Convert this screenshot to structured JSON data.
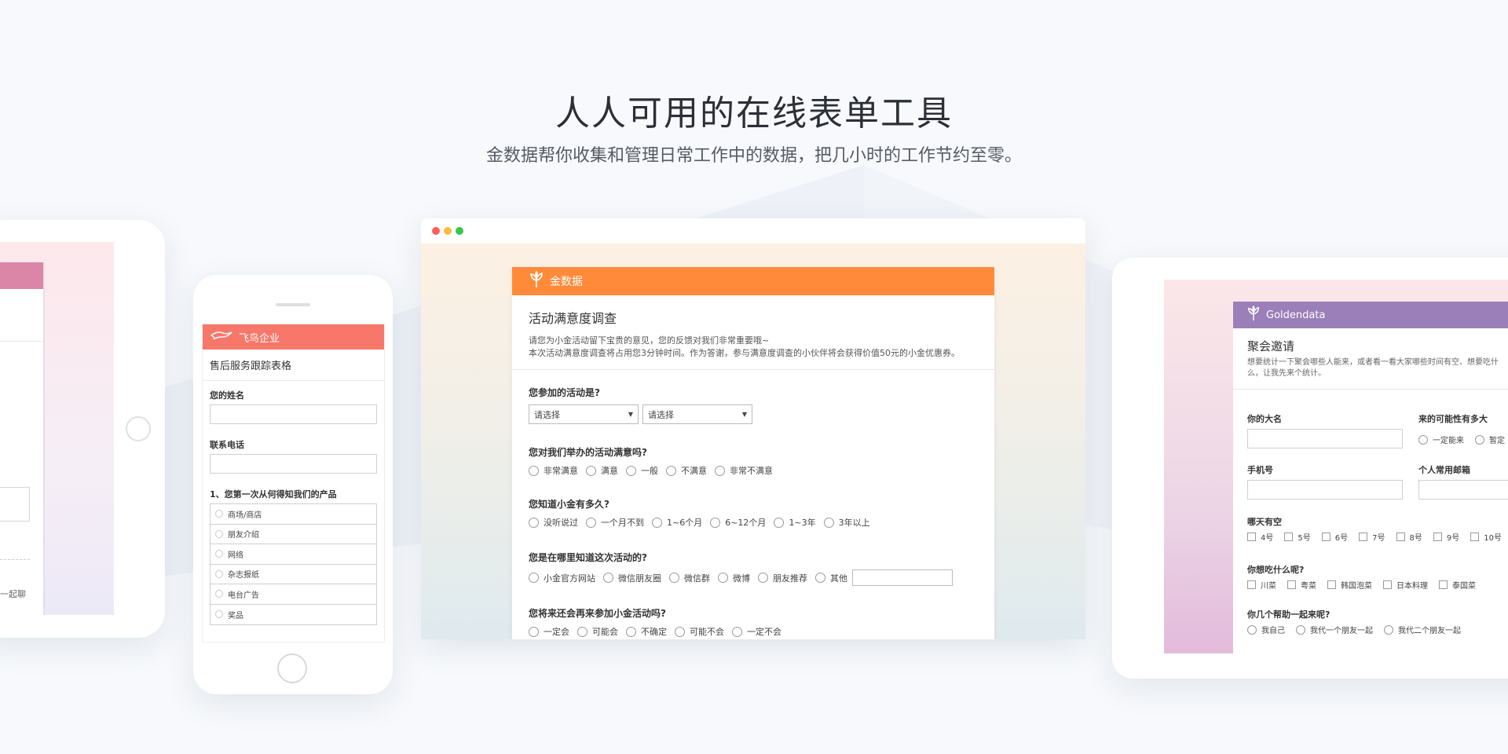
{
  "hero": {
    "title": "人人可用的在线表单工具",
    "subtitle": "金数据帮你收集和管理日常工作中的数据，把几小时的工作节约至零。"
  },
  "colors": {
    "browser_accent": "#ff8a3a",
    "phone_accent": "#f7786a",
    "tablet_right_accent": "#9a7fb8",
    "tablet_left_accent": "#db86a6"
  },
  "tablet_left": {
    "cut_text": "一起聊"
  },
  "phone": {
    "brand": "飞鸟企业",
    "logo_icon": "bird-icon",
    "form_title": "售后服务跟踪表格",
    "fields": [
      {
        "label": "您的姓名"
      },
      {
        "label": "联系电话"
      }
    ],
    "question": "1、您第一次从何得知我们的产品",
    "options": [
      "商场/商店",
      "朋友介绍",
      "网络",
      "杂志报纸",
      "电台广告",
      "奖品"
    ]
  },
  "browser": {
    "brand": "金数据",
    "logo_icon": "sprout-icon",
    "form_title": "活动满意度调查",
    "desc_line1": "请您为小金活动留下宝贵的意见，您的反馈对我们非常重要哦~",
    "desc_line2": "本次活动满意度调查将占用您3分钟时间。作为答谢，参与满意度调查的小伙伴将会获得价值50元的小金优惠券。",
    "questions": [
      {
        "label": "您参加的活动是?",
        "selects": [
          "请选择",
          "请选择"
        ]
      },
      {
        "label": "您对我们举办的活动满意吗?",
        "options": [
          "非常满意",
          "满意",
          "一般",
          "不满意",
          "非常不满意"
        ]
      },
      {
        "label": "您知道小金有多久?",
        "options": [
          "没听说过",
          "一个月不到",
          "1~6个月",
          "6~12个月",
          "1~3年",
          "3年以上"
        ]
      },
      {
        "label": "您是在哪里知道这次活动的?",
        "options": [
          "小金官方网站",
          "微信朋友圈",
          "微信群",
          "微博",
          "朋友推荐",
          "其他"
        ]
      },
      {
        "label": "您将来还会再来参加小金活动吗?",
        "options": [
          "一定会",
          "可能会",
          "不确定",
          "可能不会",
          "一定不会"
        ]
      }
    ]
  },
  "tablet_right": {
    "brand": "Goldendata",
    "logo_icon": "sprout-icon",
    "form_title": "聚会邀请",
    "desc_line1": "想要统计一下聚会哪些人能来，或者看一看大家哪些时间有空、想要吃什",
    "desc_line2": "么，让我先来个统计。",
    "name_label": "你的大名",
    "likelihood_label": "来的可能性有多大",
    "likelihood_options": [
      "一定能来",
      "暂定"
    ],
    "phone_label": "手机号",
    "email_label": "个人常用邮箱",
    "days_label": "哪天有空",
    "days": [
      "4号",
      "5号",
      "6号",
      "7号",
      "8号",
      "9号",
      "10号"
    ],
    "food_label": "你想吃什么呢?",
    "foods": [
      "川菜",
      "粤菜",
      "韩国泡菜",
      "日本料理",
      "泰国菜"
    ],
    "helpers_label": "你几个帮助一起来呢?",
    "helpers": [
      "我自己",
      "我代一个朋友一起",
      "我代二个朋友一起"
    ]
  }
}
